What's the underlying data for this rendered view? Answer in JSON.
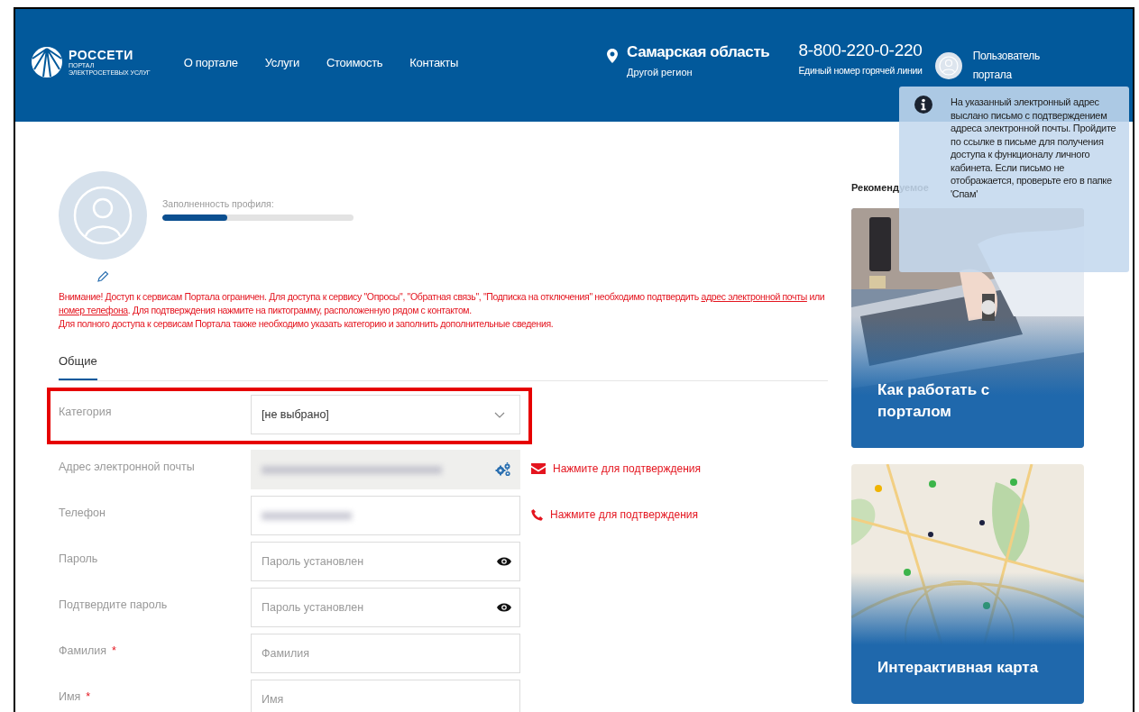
{
  "header": {
    "logo": {
      "name": "РОССЕТИ",
      "line_1": "ПОРТАЛ",
      "line_2": "ЭЛЕКТРОСЕТЕВЫХ УСЛУГ"
    },
    "nav": [
      {
        "label": "О портале"
      },
      {
        "label": "Услуги"
      },
      {
        "label": "Стоимость"
      },
      {
        "label": "Контакты"
      }
    ],
    "region": {
      "name": "Самарская область",
      "link": "Другой регион"
    },
    "hotline": {
      "phone": "8-800-220-0-220",
      "caption": "Единый номер горячей линии"
    },
    "user": {
      "line_1": "Пользователь",
      "line_2": "портала"
    }
  },
  "notification": {
    "text": "На указанный электронный адрес выслано письмо с подтверждением адреса электронной почты. Пройдите по ссылке в письме для получения доступа к функционалу личного кабинета. Если письмо не отображается, проверьте его в папке 'Спам'"
  },
  "profile": {
    "completeness_label": "Заполненность профиля:",
    "level": 0.34
  },
  "warning": {
    "paragraphs": [
      [
        {
          "kind": "text",
          "text": "Внимание! Доступ к сервисам Портала ограничен. Для доступа к сервису \"Опросы\", \"Обратная связь\", \"Подписка на отключения\" необходимо подтвердить "
        },
        {
          "kind": "link",
          "text": "адрес электронной почты"
        },
        {
          "kind": "text",
          "text": " или "
        },
        {
          "kind": "link",
          "text": "номер телефона"
        },
        {
          "kind": "text",
          "text": ". Для подтверждения нажмите на пиктограмму, расположенную рядом с контактом."
        }
      ],
      [
        {
          "kind": "text",
          "text": "Для полного доступа к сервисам Портала также необходимо указать категорию и заполнить дополнительные сведения."
        }
      ]
    ]
  },
  "tabs": [
    {
      "label": "Общие",
      "selected": true
    }
  ],
  "form": {
    "rows": [
      {
        "label": "Категория",
        "kind": "select",
        "value": "[не выбрано]",
        "highlighted": true
      },
      {
        "label": "Адрес электронной почты",
        "kind": "email",
        "disabled": true,
        "action": {
          "kind": "email",
          "text": "Нажмите для подтверждения"
        }
      },
      {
        "label": "Телефон",
        "kind": "phone",
        "disabled": false,
        "action": {
          "kind": "phone",
          "text": "Нажмите для подтверждения"
        }
      },
      {
        "label": "Пароль",
        "kind": "password",
        "placeholder": "Пароль установлен"
      },
      {
        "label": "Подтвердите пароль",
        "kind": "password",
        "placeholder": "Пароль установлен"
      },
      {
        "label": "Фамилия",
        "required_mark": "*",
        "kind": "text",
        "placeholder": "Фамилия"
      },
      {
        "label": "Имя",
        "required_mark": "*",
        "kind": "text",
        "placeholder": "Имя"
      }
    ]
  },
  "sidebar": {
    "title": "Рекомендуемое",
    "cards": [
      {
        "title": "Как работать с порталом",
        "kind": "picture"
      },
      {
        "title": "Интерактивная карта",
        "kind": "picture"
      }
    ]
  }
}
